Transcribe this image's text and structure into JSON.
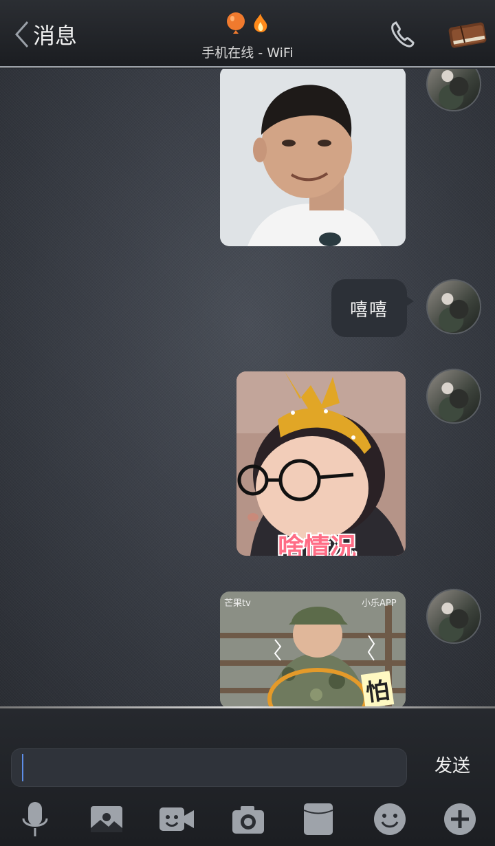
{
  "header": {
    "back_label": "消息",
    "status": "手机在线 - WiFi",
    "balloon_color": "#f07a2e",
    "flame_color": "#ff8a1a"
  },
  "messages": [
    {
      "type": "image",
      "desc_icon": "photo",
      "watermark": ""
    },
    {
      "type": "text",
      "text": "嘻嘻"
    },
    {
      "type": "image",
      "caption": "啥情况"
    },
    {
      "type": "image",
      "caption": "怕",
      "watermark_left": "芒果tv",
      "watermark_right": "小乐APP"
    }
  ],
  "composer": {
    "input_value": "",
    "input_placeholder": "",
    "send_label": "发送"
  },
  "toolbar": {
    "icons": [
      "microphone-icon",
      "picture-icon",
      "video-icon",
      "camera-icon",
      "card-icon",
      "emoji-icon",
      "plus-icon"
    ]
  },
  "accent": "#5d8ee8"
}
